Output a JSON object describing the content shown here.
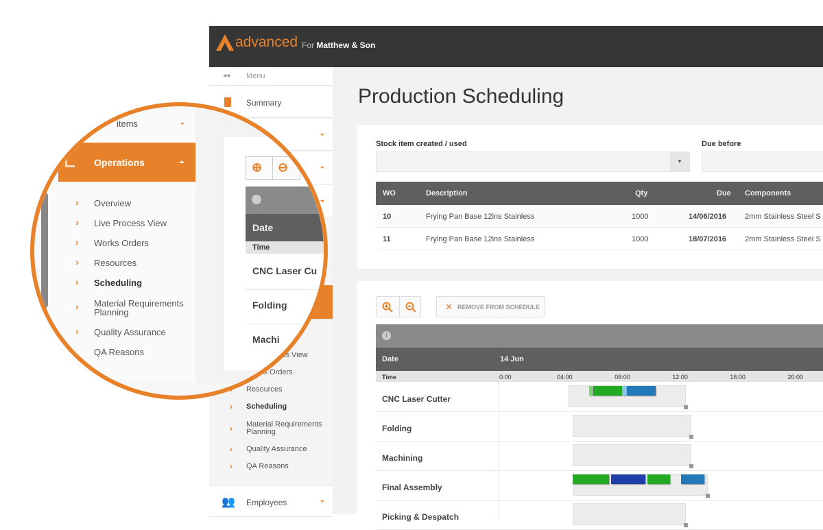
{
  "header": {
    "brand": "advanced",
    "for_label": "For",
    "company": "Matthew & Son",
    "brand_color": "#e8822a"
  },
  "sidebar": {
    "menu_label": "Menu",
    "items": [
      {
        "label": "Summary",
        "icon": "document-icon"
      },
      {
        "label": "Stock items",
        "icon": "box-icon"
      },
      {
        "label": "Operations",
        "icon": "bar-chart-icon",
        "active": true
      },
      {
        "label": "Employees",
        "icon": "users-icon"
      }
    ],
    "operations_sub": [
      "Overview",
      "Live Process View",
      "Works Orders",
      "Resources",
      "Scheduling",
      "Material Requirements Planning",
      "Quality Assurance",
      "QA Reasons"
    ],
    "active_sub": "Scheduling"
  },
  "page": {
    "title": "Production Scheduling"
  },
  "filters": {
    "stock_label": "Stock item created / used",
    "stock_value": "",
    "due_label": "Due before",
    "due_value": ""
  },
  "table": {
    "columns": [
      "WO",
      "Description",
      "Qty",
      "Due",
      "Components"
    ],
    "rows": [
      {
        "wo": "10",
        "description": "Frying Pan Base 12ins Stainless",
        "qty": "1000",
        "due": "14/06/2016",
        "components": "2mm Stainless Steel S"
      },
      {
        "wo": "11",
        "description": "Frying Pan Base 12ins Stainless",
        "qty": "1000",
        "due": "18/07/2016",
        "components": "2mm Stainless Steel S"
      }
    ]
  },
  "scheduler": {
    "remove_label": "REMOVE FROM SCHEDULE",
    "date_label": "Date",
    "date_value": "14 Jun",
    "time_label": "Time",
    "ticks": [
      "0:00",
      "04:00",
      "08:00",
      "12:00",
      "16:00",
      "20:00"
    ],
    "resources": [
      {
        "name": "CNC Laser Cutter",
        "window": [
          4.7,
          12.7
        ],
        "bars": [
          {
            "start": 6.1,
            "end": 6.4,
            "color": "#7fd36f"
          },
          {
            "start": 6.4,
            "end": 8.4,
            "color": "#22aa22"
          },
          {
            "start": 8.4,
            "end": 8.7,
            "color": "#8fc4ea"
          },
          {
            "start": 8.7,
            "end": 10.7,
            "color": "#2378b8"
          }
        ]
      },
      {
        "name": "Folding",
        "window": [
          5.0,
          13.1
        ],
        "bars": []
      },
      {
        "name": "Machining",
        "window": [
          5.0,
          13.1
        ],
        "bars": []
      },
      {
        "name": "Final Assembly",
        "window": [
          5.0,
          14.2
        ],
        "bars": [
          {
            "start": 5.0,
            "end": 7.5,
            "color": "#22aa22"
          },
          {
            "start": 7.6,
            "end": 10.0,
            "color": "#1f3fa8"
          },
          {
            "start": 10.1,
            "end": 11.7,
            "color": "#22aa22"
          },
          {
            "start": 12.4,
            "end": 14.0,
            "color": "#2378b8"
          }
        ]
      },
      {
        "name": "Picking & Despatch",
        "window": [
          5.0,
          12.7
        ],
        "bars": []
      }
    ]
  },
  "lens": {
    "partial_item": "items",
    "cnc_partial": "CNC Laser Cu",
    "folding": "Folding",
    "machining_partial": "Machi"
  }
}
